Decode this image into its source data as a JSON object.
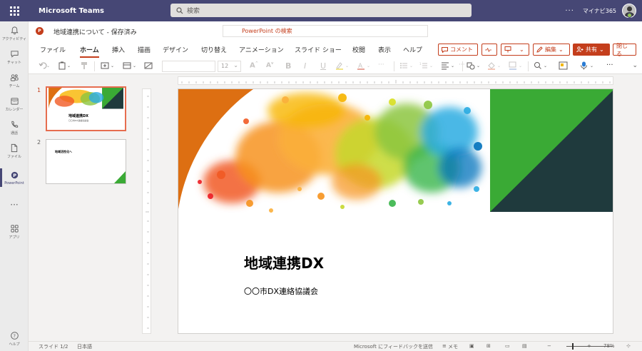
{
  "app": {
    "title": "Microsoft Teams"
  },
  "search": {
    "placeholder": "検索"
  },
  "user": {
    "name": "マイナビ365",
    "more": "···"
  },
  "rail": [
    {
      "label": "アクティビティ",
      "icon": "bell-icon"
    },
    {
      "label": "チャット",
      "icon": "chat-icon"
    },
    {
      "label": "チーム",
      "icon": "teams-icon"
    },
    {
      "label": "カレンダー",
      "icon": "calendar-icon"
    },
    {
      "label": "通話",
      "icon": "phone-icon"
    },
    {
      "label": "ファイル",
      "icon": "file-icon"
    },
    {
      "label": "PowerPoint",
      "icon": "powerpoint-icon"
    },
    {
      "label": "アプリ",
      "icon": "apps-icon"
    },
    {
      "label": "ヘルプ",
      "icon": "help-icon"
    }
  ],
  "rail_more": "···",
  "document": {
    "title": "地域連携について  -  保存済み",
    "search_label": "PowerPoint の検索",
    "logo_letter": "P"
  },
  "tabs": [
    "ファイル",
    "ホーム",
    "挿入",
    "描画",
    "デザイン",
    "切り替え",
    "アニメーション",
    "スライド ショー",
    "校閲",
    "表示",
    "ヘルプ"
  ],
  "active_tab": "ホーム",
  "buttons": {
    "comment": "コメント",
    "edit": "編集",
    "share": "共有",
    "close": "閉じる"
  },
  "ribbon": {
    "font_size": "12"
  },
  "thumbnails": [
    {
      "number": "1",
      "title": "地域連携DX",
      "subtitle": "〇〇市DX連絡協議会",
      "selected": true
    },
    {
      "number": "2",
      "title": "地域活性化へ",
      "selected": false
    }
  ],
  "slide": {
    "title": "地域連携DX",
    "subtitle": "〇〇市DX連絡協議会"
  },
  "status": {
    "slide_pos": "スライド 1/2",
    "language": "日本語",
    "feedback": "Microsoft にフィードバックを送信",
    "notes": "メモ",
    "zoom_minus": "−",
    "zoom_plus": "+",
    "zoom": "78%"
  },
  "colors": {
    "teams_bar": "#464775",
    "ppt_accent": "#c43e1c",
    "slide_orange": "#dd6f12",
    "slide_green": "#3aaa35",
    "slide_dark": "#1f3a3d"
  }
}
